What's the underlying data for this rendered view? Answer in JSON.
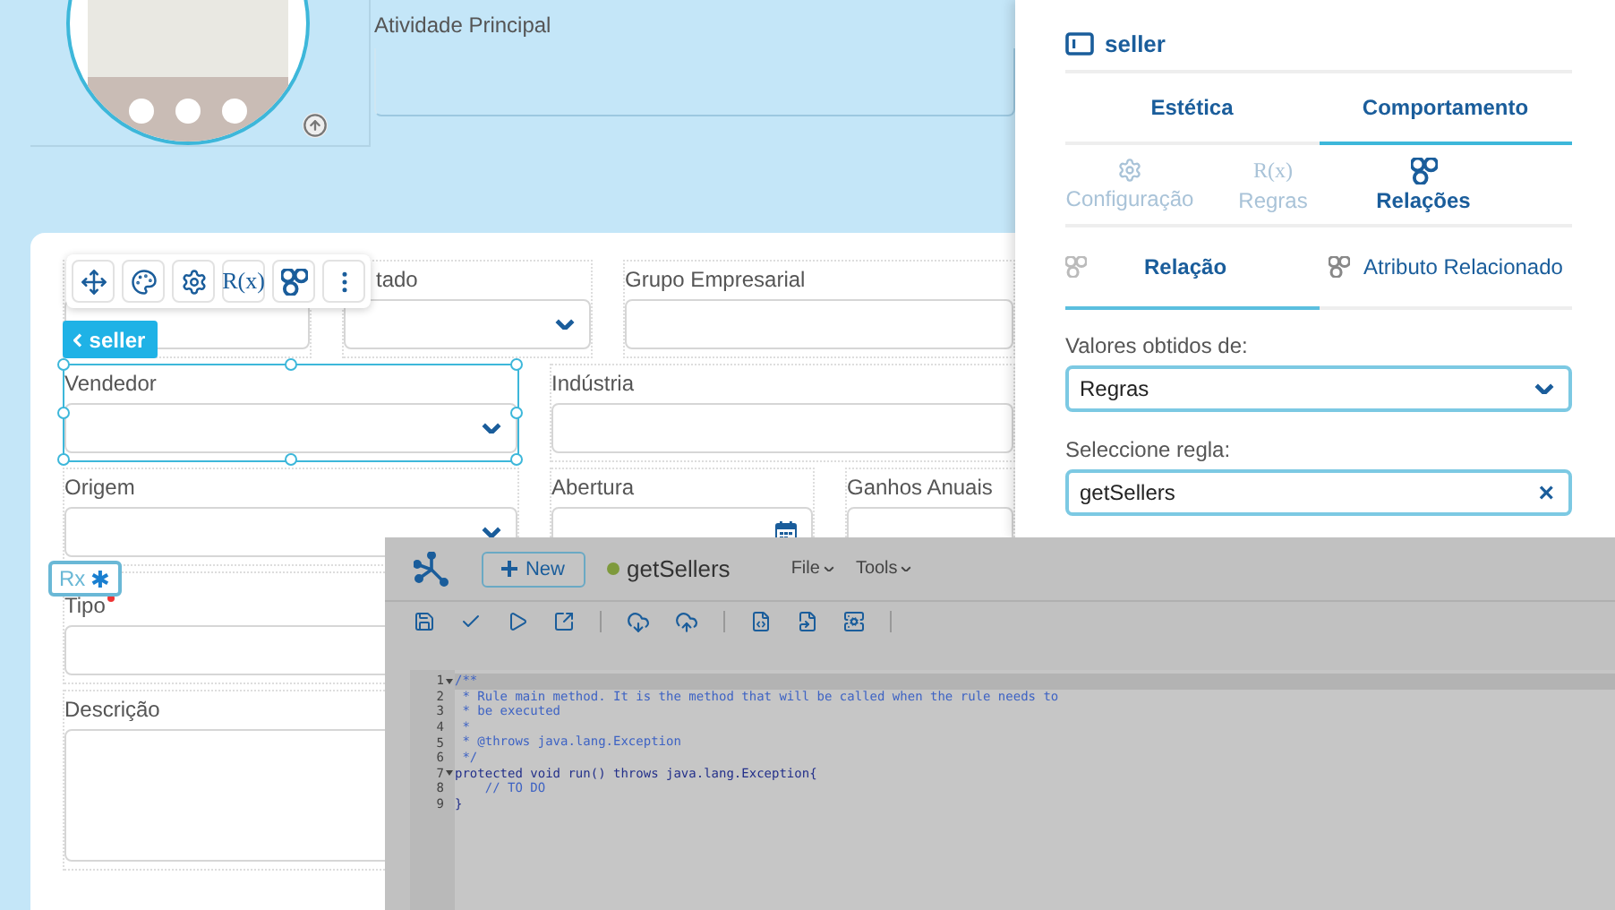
{
  "profile": {
    "activity_field": {
      "label": "Atividade Principal"
    }
  },
  "form": {
    "toolbar": {
      "rule_icon_text": "R(x)"
    },
    "component_chip": {
      "label": "seller"
    },
    "rule_badge": {
      "text": "Rx",
      "symbol": "✱"
    },
    "rows": [
      {
        "fields": [
          {
            "kind": "text",
            "selected": false
          },
          {
            "label": "tado",
            "kind": "select",
            "selected": false,
            "required": false
          },
          {
            "label": "Grupo Empresarial",
            "kind": "text",
            "selected": false,
            "required": false
          }
        ]
      },
      {
        "fields": [
          {
            "label": "Vendedor",
            "kind": "select",
            "selected": true,
            "required": false
          },
          {
            "label": "Indústria",
            "kind": "text",
            "selected": false,
            "required": false
          }
        ]
      },
      {
        "fields": [
          {
            "label": "Origem",
            "kind": "select",
            "selected": false,
            "required": false
          },
          {
            "label": "Abertura",
            "kind": "date",
            "selected": false,
            "required": false
          },
          {
            "label": "Ganhos Anuais",
            "kind": "text",
            "selected": false,
            "required": false
          }
        ]
      },
      {
        "fields": [
          {
            "label": "Tipo",
            "kind": "text",
            "selected": false,
            "required": true
          }
        ]
      },
      {
        "fields": [
          {
            "label": "Descrição",
            "kind": "textarea",
            "selected": false,
            "required": false
          }
        ]
      }
    ]
  },
  "properties_panel": {
    "title": "seller",
    "tabs": [
      {
        "label": "Estética",
        "selected": false
      },
      {
        "label": "Comportamento",
        "selected": true
      }
    ],
    "sections": [
      {
        "label": "Configuração",
        "selected": false
      },
      {
        "label": "Regras",
        "selected": false,
        "icon_text": "R(x)"
      },
      {
        "label": "Relações",
        "selected": true
      }
    ],
    "relation_tabs": [
      {
        "label": "Relação",
        "selected": true
      },
      {
        "label": "Atributo Relacionado",
        "selected": false
      }
    ],
    "values_from": {
      "label": "Valores obtidos de:",
      "value": "Regras"
    },
    "rule_select": {
      "label": "Seleccione regla:",
      "value": "getSellers",
      "clear": "×"
    }
  },
  "rule_editor": {
    "new_button": "New",
    "rule_name": "getSellers",
    "menus": [
      "File",
      "Tools"
    ],
    "lines": [
      {
        "number": "1",
        "text": "/**",
        "kind": "comment",
        "fold": true
      },
      {
        "number": "2",
        "text": " * Rule main method. It is the method that will be called when the rule needs to",
        "kind": "comment",
        "fold": false
      },
      {
        "number": "3",
        "text": " * be executed",
        "kind": "comment",
        "fold": false
      },
      {
        "number": "4",
        "text": " *",
        "kind": "comment",
        "fold": false
      },
      {
        "number": "5",
        "text": " * @throws java.lang.Exception",
        "kind": "comment",
        "fold": false
      },
      {
        "number": "6",
        "text": " */",
        "kind": "comment",
        "fold": false
      },
      {
        "number": "7",
        "text": "protected void run() throws java.lang.Exception{",
        "kind": "code",
        "fold": true
      },
      {
        "number": "8",
        "text": "    // TO DO",
        "kind": "comment",
        "fold": false
      },
      {
        "number": "9",
        "text": "}",
        "kind": "code",
        "fold": false
      }
    ]
  }
}
